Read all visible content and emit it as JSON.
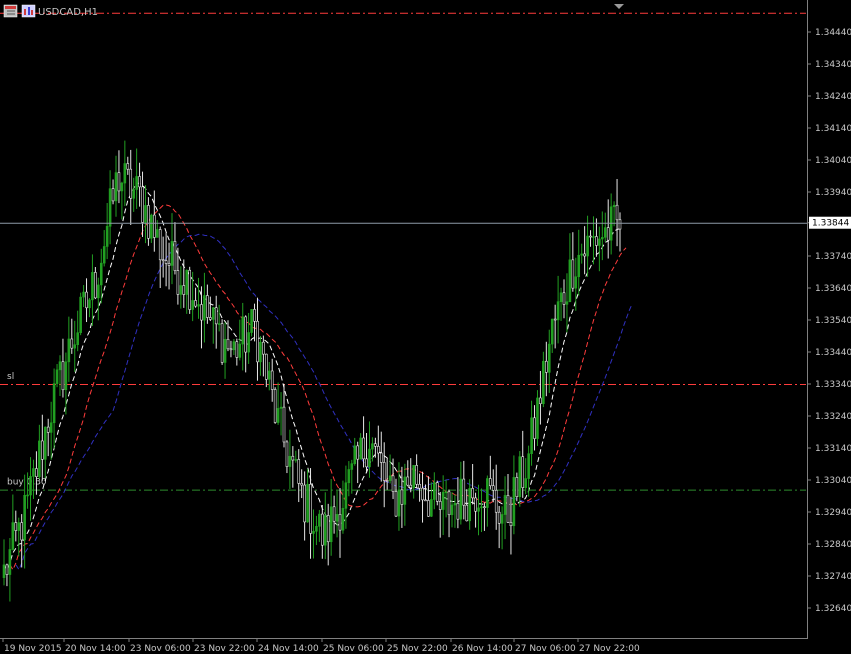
{
  "header": {
    "symbol_timeframe": "USDCAD,H1",
    "icons": [
      "window-icon",
      "chart-icon"
    ]
  },
  "chart_data": {
    "type": "candlestick",
    "symbol": "USDCAD",
    "timeframe": "H1",
    "ylim": [
      1.3259,
      1.345
    ],
    "y_ticks": [
      "1.34440",
      "1.34340",
      "1.34240",
      "1.34140",
      "1.34040",
      "1.33940",
      "1.33844",
      "1.33740",
      "1.33640",
      "1.33540",
      "1.33440",
      "1.33340",
      "1.33240",
      "1.33140",
      "1.33040",
      "1.32940",
      "1.32840",
      "1.32740",
      "1.32640"
    ],
    "x_ticks": [
      "19 Nov 2015",
      "20 Nov 14:00",
      "23 Nov 06:00",
      "23 Nov 22:00",
      "24 Nov 14:00",
      "25 Nov 06:00",
      "25 Nov 22:00",
      "26 Nov 14:00",
      "27 Nov 06:00",
      "27 Nov 22:00"
    ],
    "bid_price": "1.33844",
    "levels": [
      {
        "label": "sl",
        "price": 1.3334,
        "color": "#ff3c3c"
      },
      {
        "label": "buy 0.30",
        "price": 1.3301,
        "color": "#2e8b2e"
      },
      {
        "label": "",
        "price": 1.345,
        "color": "#ff3c3c"
      }
    ],
    "key_closes": [
      1.3275,
      1.3295,
      1.3325,
      1.3348,
      1.3366,
      1.3399,
      1.3392,
      1.3374,
      1.3367,
      1.3354,
      1.3344,
      1.3352,
      1.3322,
      1.33,
      1.3286,
      1.33,
      1.3318,
      1.3297,
      1.3306,
      1.3294,
      1.3298,
      1.3302,
      1.3292,
      1.3311,
      1.335,
      1.3373,
      1.338,
      1.3384
    ],
    "series": [
      {
        "name": "",
        "type": "ma",
        "color": "#ffffff",
        "dashed": true
      },
      {
        "name": "",
        "type": "ma",
        "color": "#ff3c3c",
        "dashed": true
      },
      {
        "name": "",
        "type": "ma",
        "color": "#3030c0",
        "dashed": true
      }
    ],
    "colors": {
      "up": "#22a022",
      "down": "#e8e8e8",
      "axis": "#808080",
      "grid_price_line": "#8e9aa8"
    }
  }
}
